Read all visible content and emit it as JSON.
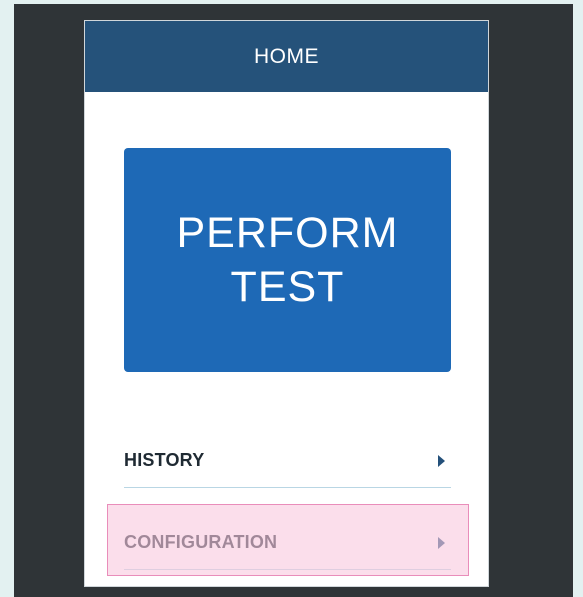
{
  "header": {
    "title": "HOME"
  },
  "perform_test": {
    "line1": "PERFORM",
    "line2": "TEST"
  },
  "menu": {
    "items": [
      {
        "label": "HISTORY",
        "icon": "chevron-right-icon"
      },
      {
        "label": "CONFIGURATION",
        "icon": "chevron-right-icon",
        "highlighted": true
      }
    ]
  },
  "colors": {
    "header_bg": "#25527a",
    "button_bg": "#1e69b6",
    "highlight_bg": "#f8c8de",
    "highlight_border": "#e98dba",
    "frame_bg": "#2f3437",
    "page_bg": "#e3f1f1"
  }
}
